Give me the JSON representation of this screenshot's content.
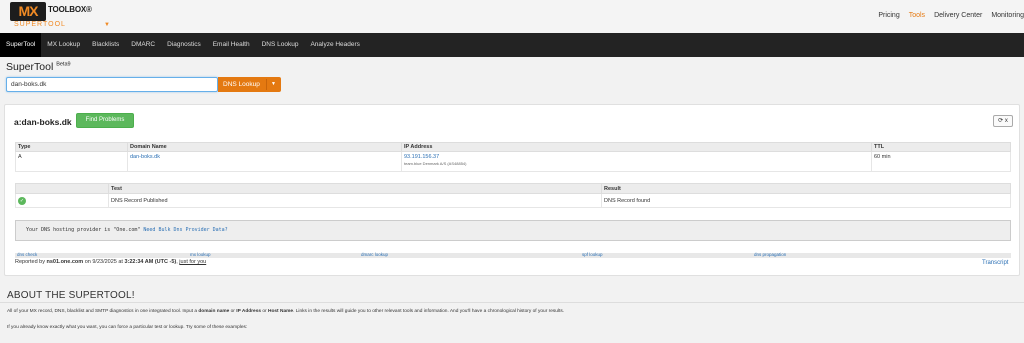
{
  "header": {
    "logo_mx": "MX",
    "logo_toolbox": "TOOLBOX",
    "logo_reg": "®",
    "logo_supertool": "SUPERTOOL",
    "top_nav": [
      "Pricing",
      "Tools",
      "Delivery Center",
      "Monitoring"
    ],
    "active_top_nav": "Tools",
    "accent_color": "#e47911"
  },
  "main_nav": [
    "SuperTool",
    "MX Lookup",
    "Blacklists",
    "DMARC",
    "Diagnostics",
    "Email Health",
    "DNS Lookup",
    "Analyze Headers"
  ],
  "page": {
    "title": "SuperTool",
    "badge": "Beta9"
  },
  "search": {
    "value": "dan-boks.dk",
    "button_label": "DNS Lookup"
  },
  "result": {
    "title": "a:dan-boks.dk",
    "find_problems": "Find Problems",
    "refresh": "⟳ x",
    "dns_headers": [
      "Type",
      "Domain Name",
      "IP Address",
      "TTL"
    ],
    "dns_row": {
      "type": "A",
      "domain": "dan-boks.dk",
      "ip": "93.191.156.37",
      "ip_sub": "team.blue Denmark A/S (AS48854)",
      "ttl": "60 min"
    },
    "test_headers": [
      "",
      "Test",
      "Result"
    ],
    "test_row": {
      "test": "DNS Record Published",
      "result": "DNS Record found"
    },
    "provider_text": "Your DNS hosting provider is \"One.com\"",
    "provider_link": "Need Bulk Dns Provider Data?",
    "tools": [
      "dns check",
      "mx lookup",
      "dmarc lookup",
      "spf lookup",
      "dns propagation"
    ],
    "reported_prefix": "Reported by",
    "reported_server": "ns01.one.com",
    "reported_mid": "on 9/23/2025 at",
    "reported_time": "3:22:34 AM (UTC -5)",
    "reported_link": "just for you",
    "transcript": "Transcript"
  },
  "about": {
    "title": "ABOUT THE SUPERTOOL!",
    "line1_a": "All of your MX record, DNS, blacklist and SMTP diagnostics in one integrated tool.  Input a",
    "line1_b1": "domain name",
    "line1_or": "or",
    "line1_b2": "IP Address",
    "line1_or2": "or",
    "line1_b3": "Host Name",
    "line1_c": ". Links in the results will guide you to other relevant tools and information.  And you'll have a chronological history of your results.",
    "line2": "If you already know exactly what you want, you can force a particular test or lookup.  Try some of these examples:"
  }
}
